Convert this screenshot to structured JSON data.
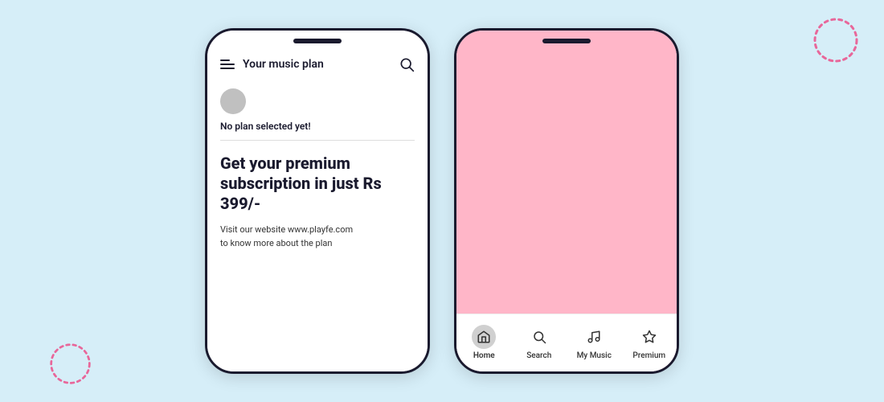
{
  "background_color": "#d6eef8",
  "phone_left": {
    "header": {
      "title": "Your music plan"
    },
    "body": {
      "no_plan_text": "No plan selected yet!",
      "promo_heading": "Get your premium subscription in just Rs 399/-",
      "promo_subtext": "Visit our website www.playfe.com\nto know more about the plan"
    }
  },
  "phone_right": {
    "bottom_nav": {
      "items": [
        {
          "id": "home",
          "label": "Home",
          "active": true
        },
        {
          "id": "search",
          "label": "Search",
          "active": false
        },
        {
          "id": "my-music",
          "label": "My Music",
          "active": false
        },
        {
          "id": "premium",
          "label": "Premium",
          "active": false
        }
      ]
    }
  },
  "decorative": {
    "dot_color": "#e8679a"
  }
}
